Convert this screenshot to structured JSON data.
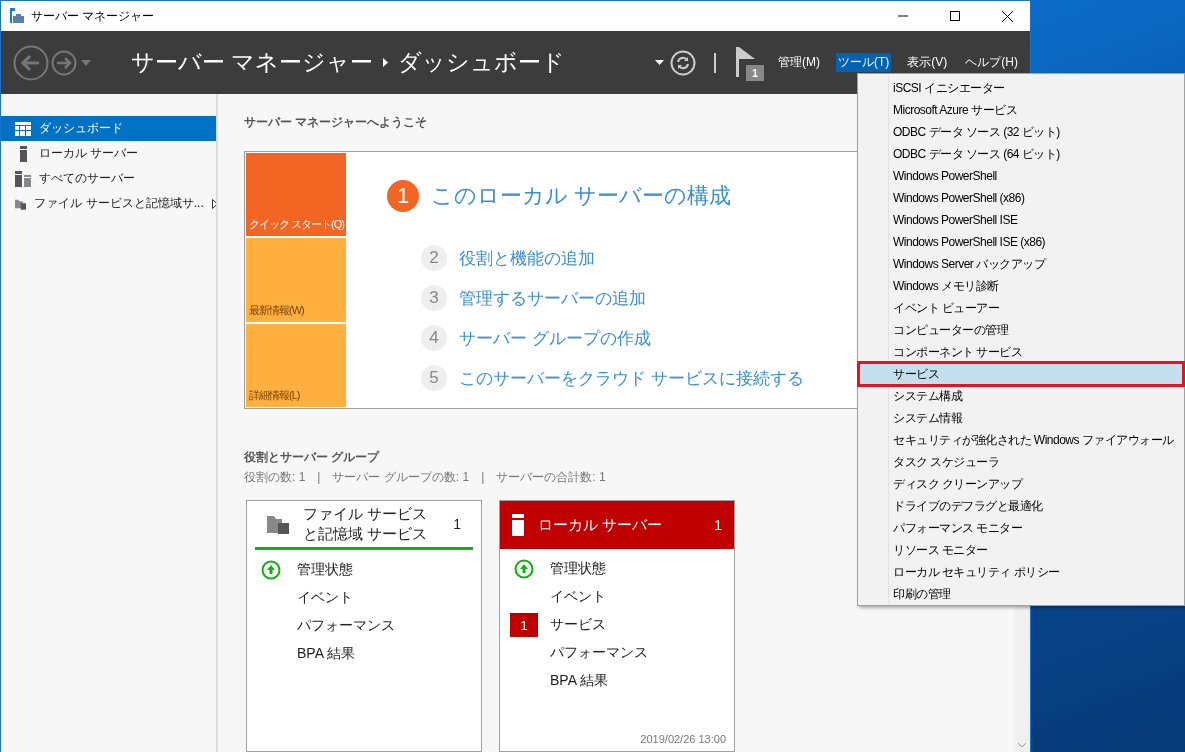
{
  "window": {
    "title": "サーバー マネージャー"
  },
  "header": {
    "breadcrumb": [
      "サーバー マネージャー",
      "ダッシュボード"
    ],
    "notification_count": "1",
    "menus": [
      {
        "label": "管理(M)",
        "selected": false
      },
      {
        "label": "ツール(T)",
        "selected": true
      },
      {
        "label": "表示(V)",
        "selected": false
      },
      {
        "label": "ヘルプ(H)",
        "selected": false
      }
    ]
  },
  "sidebar": {
    "items": [
      {
        "label": "ダッシュボード",
        "kind": "dashboard",
        "selected": true
      },
      {
        "label": "ローカル サーバー",
        "kind": "server",
        "selected": false
      },
      {
        "label": "すべてのサーバー",
        "kind": "servers",
        "selected": false
      },
      {
        "label": "ファイル サービスと記憶域サ...",
        "kind": "files",
        "selected": false,
        "has_submenu": true
      }
    ]
  },
  "welcome": {
    "title": "サーバー マネージャーへようこそ",
    "tiles": [
      {
        "label": "クイック スタート(Q)",
        "selected": true
      },
      {
        "label": "最新情報(W)",
        "selected": false
      },
      {
        "label": "詳細情報(L)",
        "selected": false
      }
    ],
    "steps": [
      {
        "number": "1",
        "label": "このローカル サーバーの構成",
        "current": true
      },
      {
        "number": "2",
        "label": "役割と機能の追加",
        "current": false
      },
      {
        "number": "3",
        "label": "管理するサーバーの追加",
        "current": false
      },
      {
        "number": "4",
        "label": "サーバー グループの作成",
        "current": false
      },
      {
        "number": "5",
        "label": "このサーバーをクラウド サービスに接続する",
        "current": false
      }
    ]
  },
  "roles": {
    "title": "役割とサーバー グループ",
    "summary": "役割の数: 1　|　サーバー グループの数: 1　|　サーバーの合計数: 1",
    "cards": [
      {
        "title": "ファイル サービスと記憶域 サービス",
        "count": "1",
        "kind": "ok",
        "items": [
          {
            "label": "管理状態",
            "kind": "ok"
          },
          {
            "label": "イベント",
            "kind": "plain"
          },
          {
            "label": "パフォーマンス",
            "kind": "plain"
          },
          {
            "label": "BPA 結果",
            "kind": "plain"
          }
        ]
      },
      {
        "title": "ローカル サーバー",
        "count": "1",
        "kind": "alert",
        "timestamp": "2019/02/26 13:00",
        "items": [
          {
            "label": "管理状態",
            "kind": "ok"
          },
          {
            "label": "イベント",
            "kind": "plain"
          },
          {
            "label": "サービス",
            "kind": "alert",
            "badge": "1"
          },
          {
            "label": "パフォーマンス",
            "kind": "plain"
          },
          {
            "label": "BPA 結果",
            "kind": "plain"
          }
        ]
      }
    ]
  },
  "tools_menu": {
    "items": [
      {
        "label": "iSCSI イニシエーター",
        "selected": false
      },
      {
        "label": "Microsoft Azure サービス",
        "selected": false
      },
      {
        "label": "ODBC データ ソース (32 ビット)",
        "selected": false
      },
      {
        "label": "ODBC データ ソース (64 ビット)",
        "selected": false
      },
      {
        "label": "Windows PowerShell",
        "selected": false
      },
      {
        "label": "Windows PowerShell (x86)",
        "selected": false
      },
      {
        "label": "Windows PowerShell ISE",
        "selected": false
      },
      {
        "label": "Windows PowerShell ISE (x86)",
        "selected": false
      },
      {
        "label": "Windows Server バックアップ",
        "selected": false
      },
      {
        "label": "Windows メモリ診断",
        "selected": false
      },
      {
        "label": "イベント ビューアー",
        "selected": false
      },
      {
        "label": "コンピューターの管理",
        "selected": false
      },
      {
        "label": "コンポーネント サービス",
        "selected": false
      },
      {
        "label": "サービス",
        "selected": true
      },
      {
        "label": "システム構成",
        "selected": false
      },
      {
        "label": "システム情報",
        "selected": false
      },
      {
        "label": "セキュリティが強化された Windows ファイアウォール",
        "selected": false
      },
      {
        "label": "タスク スケジューラ",
        "selected": false
      },
      {
        "label": "ディスク クリーンアップ",
        "selected": false
      },
      {
        "label": "ドライブのデフラグと最適化",
        "selected": false
      },
      {
        "label": "パフォーマンス モニター",
        "selected": false
      },
      {
        "label": "リソース モニター",
        "selected": false
      },
      {
        "label": "ローカル セキュリティ ポリシー",
        "selected": false
      },
      {
        "label": "印刷の管理",
        "selected": false
      }
    ]
  }
}
